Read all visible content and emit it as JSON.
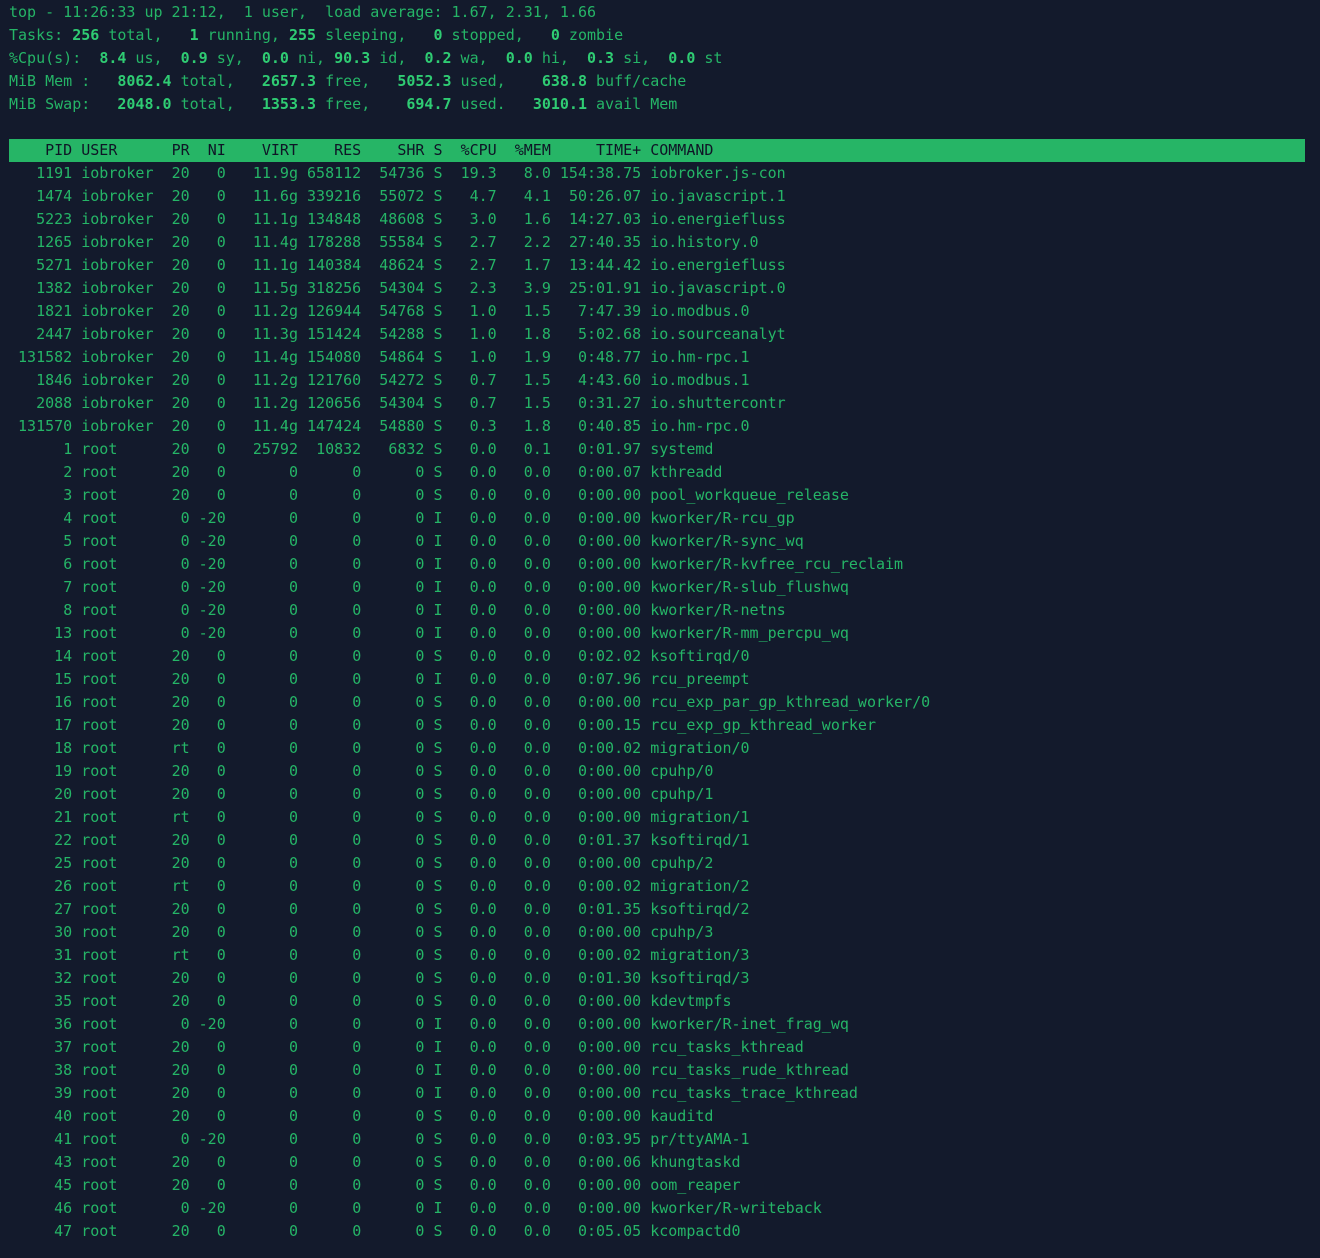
{
  "summary": {
    "uptime_line": "top - 11:26:33 up 21:12,  1 user,  load average: 1.67, 2.31, 1.66",
    "tasks": {
      "total": "256",
      "running": "1",
      "sleeping": "255",
      "stopped": "0",
      "zombie": "0"
    },
    "cpu": {
      "us": "8.4",
      "sy": "0.9",
      "ni": "0.0",
      "id": "90.3",
      "wa": "0.2",
      "hi": "0.0",
      "si": "0.3",
      "st": "0.0"
    },
    "mem": {
      "total": "8062.4",
      "free": "2657.3",
      "used": "5052.3",
      "buff_cache": "638.8"
    },
    "swap": {
      "total": "2048.0",
      "free": "1353.3",
      "used": "694.7",
      "avail_mem": "3010.1"
    }
  },
  "columns": [
    "PID",
    "USER",
    "PR",
    "NI",
    "VIRT",
    "RES",
    "SHR",
    "S",
    "%CPU",
    "%MEM",
    "TIME+",
    "COMMAND"
  ],
  "processes": [
    [
      "1191",
      "iobroker",
      "20",
      "0",
      "11.9g",
      "658112",
      "54736",
      "S",
      "19.3",
      "8.0",
      "154:38.75",
      "iobroker.js-con"
    ],
    [
      "1474",
      "iobroker",
      "20",
      "0",
      "11.6g",
      "339216",
      "55072",
      "S",
      "4.7",
      "4.1",
      "50:26.07",
      "io.javascript.1"
    ],
    [
      "5223",
      "iobroker",
      "20",
      "0",
      "11.1g",
      "134848",
      "48608",
      "S",
      "3.0",
      "1.6",
      "14:27.03",
      "io.energiefluss"
    ],
    [
      "1265",
      "iobroker",
      "20",
      "0",
      "11.4g",
      "178288",
      "55584",
      "S",
      "2.7",
      "2.2",
      "27:40.35",
      "io.history.0"
    ],
    [
      "5271",
      "iobroker",
      "20",
      "0",
      "11.1g",
      "140384",
      "48624",
      "S",
      "2.7",
      "1.7",
      "13:44.42",
      "io.energiefluss"
    ],
    [
      "1382",
      "iobroker",
      "20",
      "0",
      "11.5g",
      "318256",
      "54304",
      "S",
      "2.3",
      "3.9",
      "25:01.91",
      "io.javascript.0"
    ],
    [
      "1821",
      "iobroker",
      "20",
      "0",
      "11.2g",
      "126944",
      "54768",
      "S",
      "1.0",
      "1.5",
      "7:47.39",
      "io.modbus.0"
    ],
    [
      "2447",
      "iobroker",
      "20",
      "0",
      "11.3g",
      "151424",
      "54288",
      "S",
      "1.0",
      "1.8",
      "5:02.68",
      "io.sourceanalyt"
    ],
    [
      "131582",
      "iobroker",
      "20",
      "0",
      "11.4g",
      "154080",
      "54864",
      "S",
      "1.0",
      "1.9",
      "0:48.77",
      "io.hm-rpc.1"
    ],
    [
      "1846",
      "iobroker",
      "20",
      "0",
      "11.2g",
      "121760",
      "54272",
      "S",
      "0.7",
      "1.5",
      "4:43.60",
      "io.modbus.1"
    ],
    [
      "2088",
      "iobroker",
      "20",
      "0",
      "11.2g",
      "120656",
      "54304",
      "S",
      "0.7",
      "1.5",
      "0:31.27",
      "io.shuttercontr"
    ],
    [
      "131570",
      "iobroker",
      "20",
      "0",
      "11.4g",
      "147424",
      "54880",
      "S",
      "0.3",
      "1.8",
      "0:40.85",
      "io.hm-rpc.0"
    ],
    [
      "1",
      "root",
      "20",
      "0",
      "25792",
      "10832",
      "6832",
      "S",
      "0.0",
      "0.1",
      "0:01.97",
      "systemd"
    ],
    [
      "2",
      "root",
      "20",
      "0",
      "0",
      "0",
      "0",
      "S",
      "0.0",
      "0.0",
      "0:00.07",
      "kthreadd"
    ],
    [
      "3",
      "root",
      "20",
      "0",
      "0",
      "0",
      "0",
      "S",
      "0.0",
      "0.0",
      "0:00.00",
      "pool_workqueue_release"
    ],
    [
      "4",
      "root",
      "0",
      "-20",
      "0",
      "0",
      "0",
      "I",
      "0.0",
      "0.0",
      "0:00.00",
      "kworker/R-rcu_gp"
    ],
    [
      "5",
      "root",
      "0",
      "-20",
      "0",
      "0",
      "0",
      "I",
      "0.0",
      "0.0",
      "0:00.00",
      "kworker/R-sync_wq"
    ],
    [
      "6",
      "root",
      "0",
      "-20",
      "0",
      "0",
      "0",
      "I",
      "0.0",
      "0.0",
      "0:00.00",
      "kworker/R-kvfree_rcu_reclaim"
    ],
    [
      "7",
      "root",
      "0",
      "-20",
      "0",
      "0",
      "0",
      "I",
      "0.0",
      "0.0",
      "0:00.00",
      "kworker/R-slub_flushwq"
    ],
    [
      "8",
      "root",
      "0",
      "-20",
      "0",
      "0",
      "0",
      "I",
      "0.0",
      "0.0",
      "0:00.00",
      "kworker/R-netns"
    ],
    [
      "13",
      "root",
      "0",
      "-20",
      "0",
      "0",
      "0",
      "I",
      "0.0",
      "0.0",
      "0:00.00",
      "kworker/R-mm_percpu_wq"
    ],
    [
      "14",
      "root",
      "20",
      "0",
      "0",
      "0",
      "0",
      "S",
      "0.0",
      "0.0",
      "0:02.02",
      "ksoftirqd/0"
    ],
    [
      "15",
      "root",
      "20",
      "0",
      "0",
      "0",
      "0",
      "I",
      "0.0",
      "0.0",
      "0:07.96",
      "rcu_preempt"
    ],
    [
      "16",
      "root",
      "20",
      "0",
      "0",
      "0",
      "0",
      "S",
      "0.0",
      "0.0",
      "0:00.00",
      "rcu_exp_par_gp_kthread_worker/0"
    ],
    [
      "17",
      "root",
      "20",
      "0",
      "0",
      "0",
      "0",
      "S",
      "0.0",
      "0.0",
      "0:00.15",
      "rcu_exp_gp_kthread_worker"
    ],
    [
      "18",
      "root",
      "rt",
      "0",
      "0",
      "0",
      "0",
      "S",
      "0.0",
      "0.0",
      "0:00.02",
      "migration/0"
    ],
    [
      "19",
      "root",
      "20",
      "0",
      "0",
      "0",
      "0",
      "S",
      "0.0",
      "0.0",
      "0:00.00",
      "cpuhp/0"
    ],
    [
      "20",
      "root",
      "20",
      "0",
      "0",
      "0",
      "0",
      "S",
      "0.0",
      "0.0",
      "0:00.00",
      "cpuhp/1"
    ],
    [
      "21",
      "root",
      "rt",
      "0",
      "0",
      "0",
      "0",
      "S",
      "0.0",
      "0.0",
      "0:00.00",
      "migration/1"
    ],
    [
      "22",
      "root",
      "20",
      "0",
      "0",
      "0",
      "0",
      "S",
      "0.0",
      "0.0",
      "0:01.37",
      "ksoftirqd/1"
    ],
    [
      "25",
      "root",
      "20",
      "0",
      "0",
      "0",
      "0",
      "S",
      "0.0",
      "0.0",
      "0:00.00",
      "cpuhp/2"
    ],
    [
      "26",
      "root",
      "rt",
      "0",
      "0",
      "0",
      "0",
      "S",
      "0.0",
      "0.0",
      "0:00.02",
      "migration/2"
    ],
    [
      "27",
      "root",
      "20",
      "0",
      "0",
      "0",
      "0",
      "S",
      "0.0",
      "0.0",
      "0:01.35",
      "ksoftirqd/2"
    ],
    [
      "30",
      "root",
      "20",
      "0",
      "0",
      "0",
      "0",
      "S",
      "0.0",
      "0.0",
      "0:00.00",
      "cpuhp/3"
    ],
    [
      "31",
      "root",
      "rt",
      "0",
      "0",
      "0",
      "0",
      "S",
      "0.0",
      "0.0",
      "0:00.02",
      "migration/3"
    ],
    [
      "32",
      "root",
      "20",
      "0",
      "0",
      "0",
      "0",
      "S",
      "0.0",
      "0.0",
      "0:01.30",
      "ksoftirqd/3"
    ],
    [
      "35",
      "root",
      "20",
      "0",
      "0",
      "0",
      "0",
      "S",
      "0.0",
      "0.0",
      "0:00.00",
      "kdevtmpfs"
    ],
    [
      "36",
      "root",
      "0",
      "-20",
      "0",
      "0",
      "0",
      "I",
      "0.0",
      "0.0",
      "0:00.00",
      "kworker/R-inet_frag_wq"
    ],
    [
      "37",
      "root",
      "20",
      "0",
      "0",
      "0",
      "0",
      "I",
      "0.0",
      "0.0",
      "0:00.00",
      "rcu_tasks_kthread"
    ],
    [
      "38",
      "root",
      "20",
      "0",
      "0",
      "0",
      "0",
      "I",
      "0.0",
      "0.0",
      "0:00.00",
      "rcu_tasks_rude_kthread"
    ],
    [
      "39",
      "root",
      "20",
      "0",
      "0",
      "0",
      "0",
      "I",
      "0.0",
      "0.0",
      "0:00.00",
      "rcu_tasks_trace_kthread"
    ],
    [
      "40",
      "root",
      "20",
      "0",
      "0",
      "0",
      "0",
      "S",
      "0.0",
      "0.0",
      "0:00.00",
      "kauditd"
    ],
    [
      "41",
      "root",
      "0",
      "-20",
      "0",
      "0",
      "0",
      "S",
      "0.0",
      "0.0",
      "0:03.95",
      "pr/ttyAMA-1"
    ],
    [
      "43",
      "root",
      "20",
      "0",
      "0",
      "0",
      "0",
      "S",
      "0.0",
      "0.0",
      "0:00.06",
      "khungtaskd"
    ],
    [
      "45",
      "root",
      "20",
      "0",
      "0",
      "0",
      "0",
      "S",
      "0.0",
      "0.0",
      "0:00.00",
      "oom_reaper"
    ],
    [
      "46",
      "root",
      "0",
      "-20",
      "0",
      "0",
      "0",
      "I",
      "0.0",
      "0.0",
      "0:00.00",
      "kworker/R-writeback"
    ],
    [
      "47",
      "root",
      "20",
      "0",
      "0",
      "0",
      "0",
      "S",
      "0.0",
      "0.0",
      "0:05.05",
      "kcompactd0"
    ]
  ],
  "colors": {
    "background": "#131a2c",
    "text": "#25b567",
    "header_bar": "#26b566",
    "header_text": "#0f1526"
  }
}
